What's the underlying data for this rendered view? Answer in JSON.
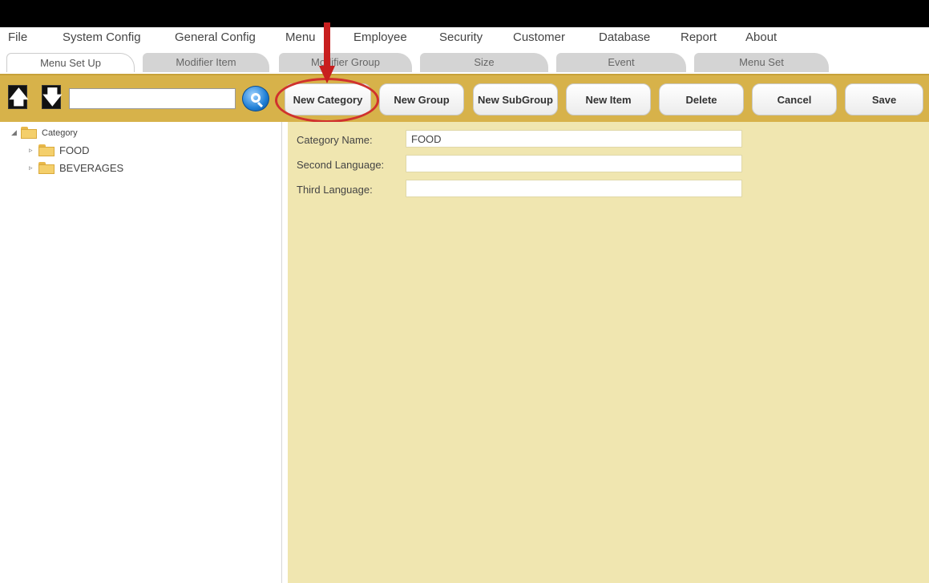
{
  "menubar": {
    "items": [
      "File",
      "System Config",
      "General Config",
      "Menu",
      "Employee",
      "Security",
      "Customer",
      "Database",
      "Report",
      "About"
    ]
  },
  "tabs": [
    "Menu Set Up",
    "Modifier Item",
    "Modifier Group",
    "Size",
    "Event",
    "Menu Set"
  ],
  "toolbar": {
    "up_arrow": "🡅",
    "down_arrow": "🡇",
    "search_value": "",
    "buttons": {
      "new_category": "New Category",
      "new_group": "New Group",
      "new_subgroup": "New SubGroup",
      "new_item": "New Item",
      "delete": "Delete",
      "cancel": "Cancel",
      "save": "Save"
    }
  },
  "tree": {
    "root": "Category",
    "children": [
      "FOOD",
      "BEVERAGES"
    ]
  },
  "form": {
    "category_name_label": "Category Name:",
    "category_name_value": "FOOD",
    "second_language_label": "Second Language:",
    "second_language_value": "",
    "third_language_label": "Third Language:",
    "third_language_value": ""
  },
  "colors": {
    "toolbar_gold": "#d7b24a",
    "form_bg": "#f0e6b0",
    "annotation_red": "#c81f1f"
  }
}
